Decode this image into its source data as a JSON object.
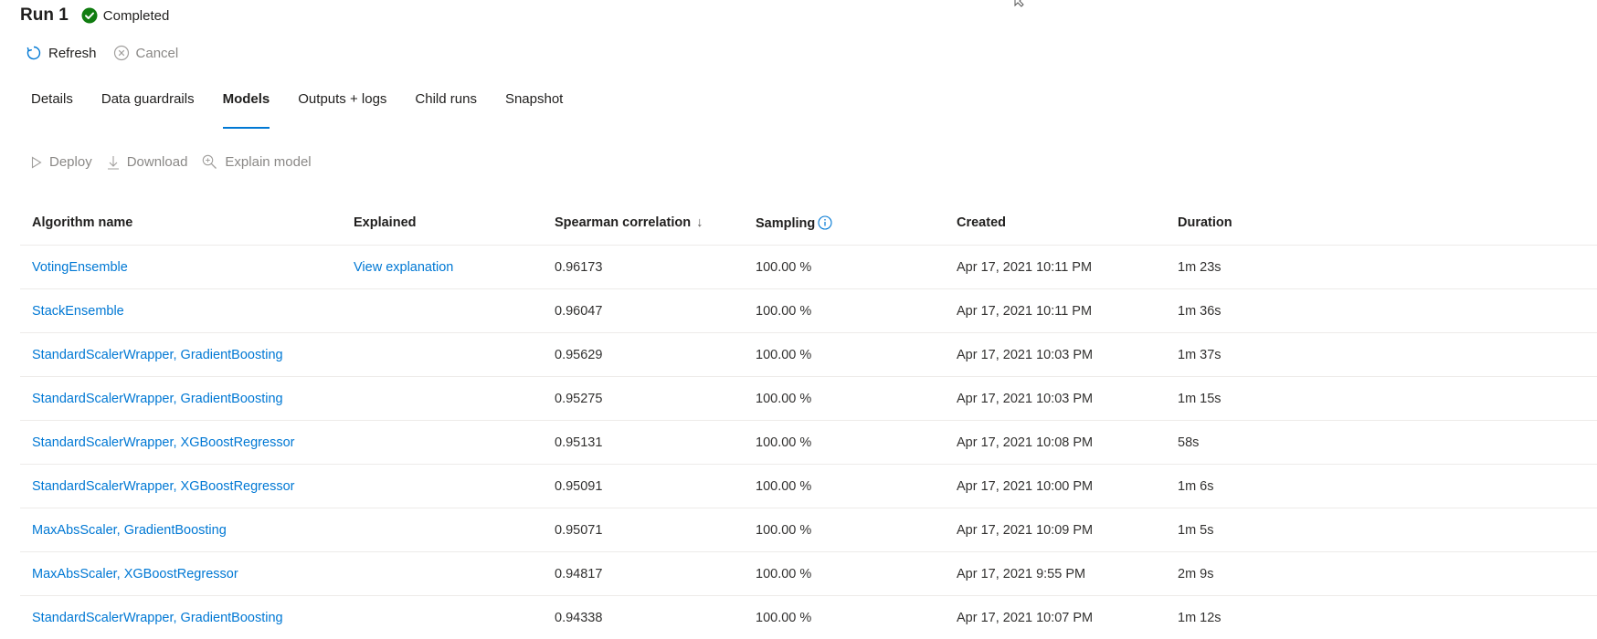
{
  "header": {
    "run_title": "Run 1",
    "status": "Completed",
    "status_color": "#107c10"
  },
  "commands": {
    "refresh": "Refresh",
    "cancel": "Cancel"
  },
  "tabs": [
    {
      "label": "Details",
      "active": false
    },
    {
      "label": "Data guardrails",
      "active": false
    },
    {
      "label": "Models",
      "active": true
    },
    {
      "label": "Outputs + logs",
      "active": false
    },
    {
      "label": "Child runs",
      "active": false
    },
    {
      "label": "Snapshot",
      "active": false
    }
  ],
  "toolbar": {
    "deploy": "Deploy",
    "download": "Download",
    "explain": "Explain model"
  },
  "table": {
    "columns": {
      "algorithm": "Algorithm name",
      "explained": "Explained",
      "spearman": "Spearman correlation",
      "sort_indicator": "↓",
      "sampling": "Sampling",
      "created": "Created",
      "duration": "Duration"
    },
    "rows": [
      {
        "algorithm": "VotingEnsemble",
        "explained": "View explanation",
        "spearman": "0.96173",
        "sampling": "100.00 %",
        "created": "Apr 17, 2021 10:11 PM",
        "duration": "1m 23s"
      },
      {
        "algorithm": "StackEnsemble",
        "explained": "",
        "spearman": "0.96047",
        "sampling": "100.00 %",
        "created": "Apr 17, 2021 10:11 PM",
        "duration": "1m 36s"
      },
      {
        "algorithm": "StandardScalerWrapper, GradientBoosting",
        "explained": "",
        "spearman": "0.95629",
        "sampling": "100.00 %",
        "created": "Apr 17, 2021 10:03 PM",
        "duration": "1m 37s"
      },
      {
        "algorithm": "StandardScalerWrapper, GradientBoosting",
        "explained": "",
        "spearman": "0.95275",
        "sampling": "100.00 %",
        "created": "Apr 17, 2021 10:03 PM",
        "duration": "1m 15s"
      },
      {
        "algorithm": "StandardScalerWrapper, XGBoostRegressor",
        "explained": "",
        "spearman": "0.95131",
        "sampling": "100.00 %",
        "created": "Apr 17, 2021 10:08 PM",
        "duration": "58s"
      },
      {
        "algorithm": "StandardScalerWrapper, XGBoostRegressor",
        "explained": "",
        "spearman": "0.95091",
        "sampling": "100.00 %",
        "created": "Apr 17, 2021 10:00 PM",
        "duration": "1m 6s"
      },
      {
        "algorithm": "MaxAbsScaler, GradientBoosting",
        "explained": "",
        "spearman": "0.95071",
        "sampling": "100.00 %",
        "created": "Apr 17, 2021 10:09 PM",
        "duration": "1m 5s"
      },
      {
        "algorithm": "MaxAbsScaler, XGBoostRegressor",
        "explained": "",
        "spearman": "0.94817",
        "sampling": "100.00 %",
        "created": "Apr 17, 2021 9:55 PM",
        "duration": "2m 9s"
      },
      {
        "algorithm": "StandardScalerWrapper, GradientBoosting",
        "explained": "",
        "spearman": "0.94338",
        "sampling": "100.00 %",
        "created": "Apr 17, 2021 10:07 PM",
        "duration": "1m 12s"
      }
    ]
  },
  "colors": {
    "accent": "#0078d4",
    "disabled": "#8a8886"
  }
}
